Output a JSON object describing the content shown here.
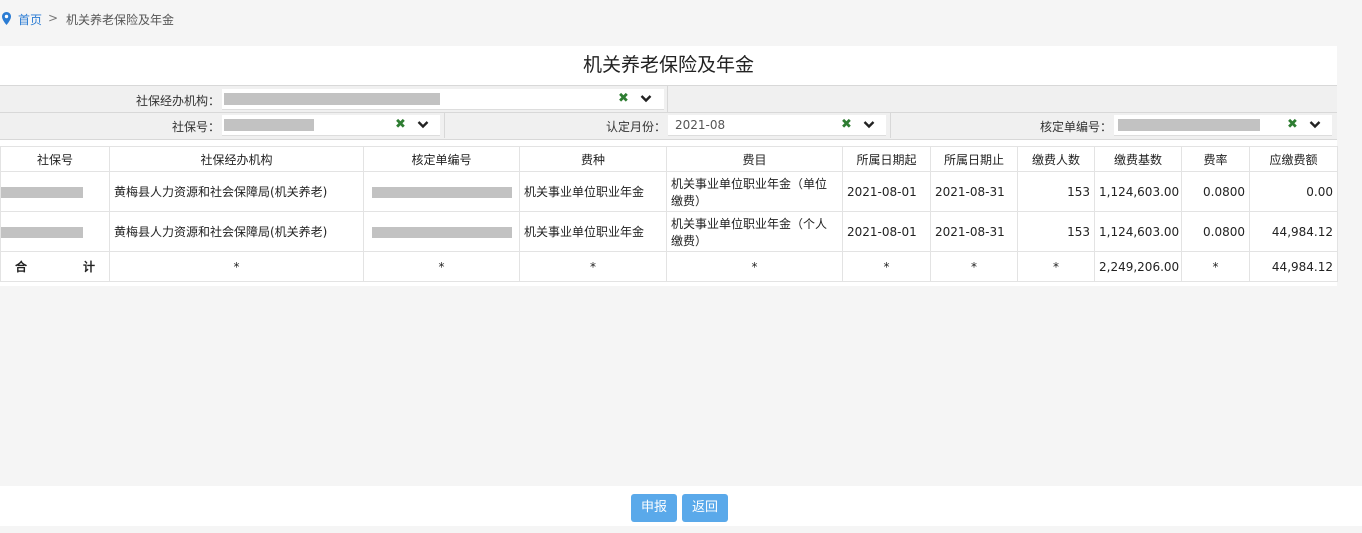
{
  "breadcrumb": {
    "home": "首页",
    "separator": ">",
    "current": "机关养老保险及年金"
  },
  "page_title": "机关养老保险及年金",
  "form": {
    "agency_label": "社保经办机构：",
    "ssn_label": "社保号：",
    "month_label": "认定月份：",
    "month_value": "2021-08",
    "approval_label": "核定单编号：",
    "clear_glyph": "✖"
  },
  "table": {
    "headers": [
      "社保号",
      "社保经办机构",
      "核定单编号",
      "费种",
      "费目",
      "所属日期起",
      "所属日期止",
      "缴费人数",
      "缴费基数",
      "费率",
      "应缴费额"
    ],
    "rows": [
      {
        "agency": "黄梅县人力资源和社会保障局(机关养老)",
        "fee_type": "机关事业单位职业年金",
        "fee_item": "机关事业单位职业年金（单位缴费）",
        "start": "2021-08-01",
        "end": "2021-08-31",
        "count": "153",
        "base": "1,124,603.00",
        "rate": "0.0800",
        "amount": "0.00"
      },
      {
        "agency": "黄梅县人力资源和社会保障局(机关养老)",
        "fee_type": "机关事业单位职业年金",
        "fee_item": "机关事业单位职业年金（个人缴费）",
        "start": "2021-08-01",
        "end": "2021-08-31",
        "count": "153",
        "base": "1,124,603.00",
        "rate": "0.0800",
        "amount": "44,984.12"
      }
    ],
    "summary": {
      "label_a": "合",
      "label_b": "计",
      "star": "*",
      "base": "2,249,206.00",
      "amount": "44,984.12"
    }
  },
  "buttons": {
    "submit": "申报",
    "back": "返回"
  },
  "colors": {
    "accent": "#5aa9ea",
    "link": "#2b7cd3",
    "clear": "#2e7d32"
  }
}
